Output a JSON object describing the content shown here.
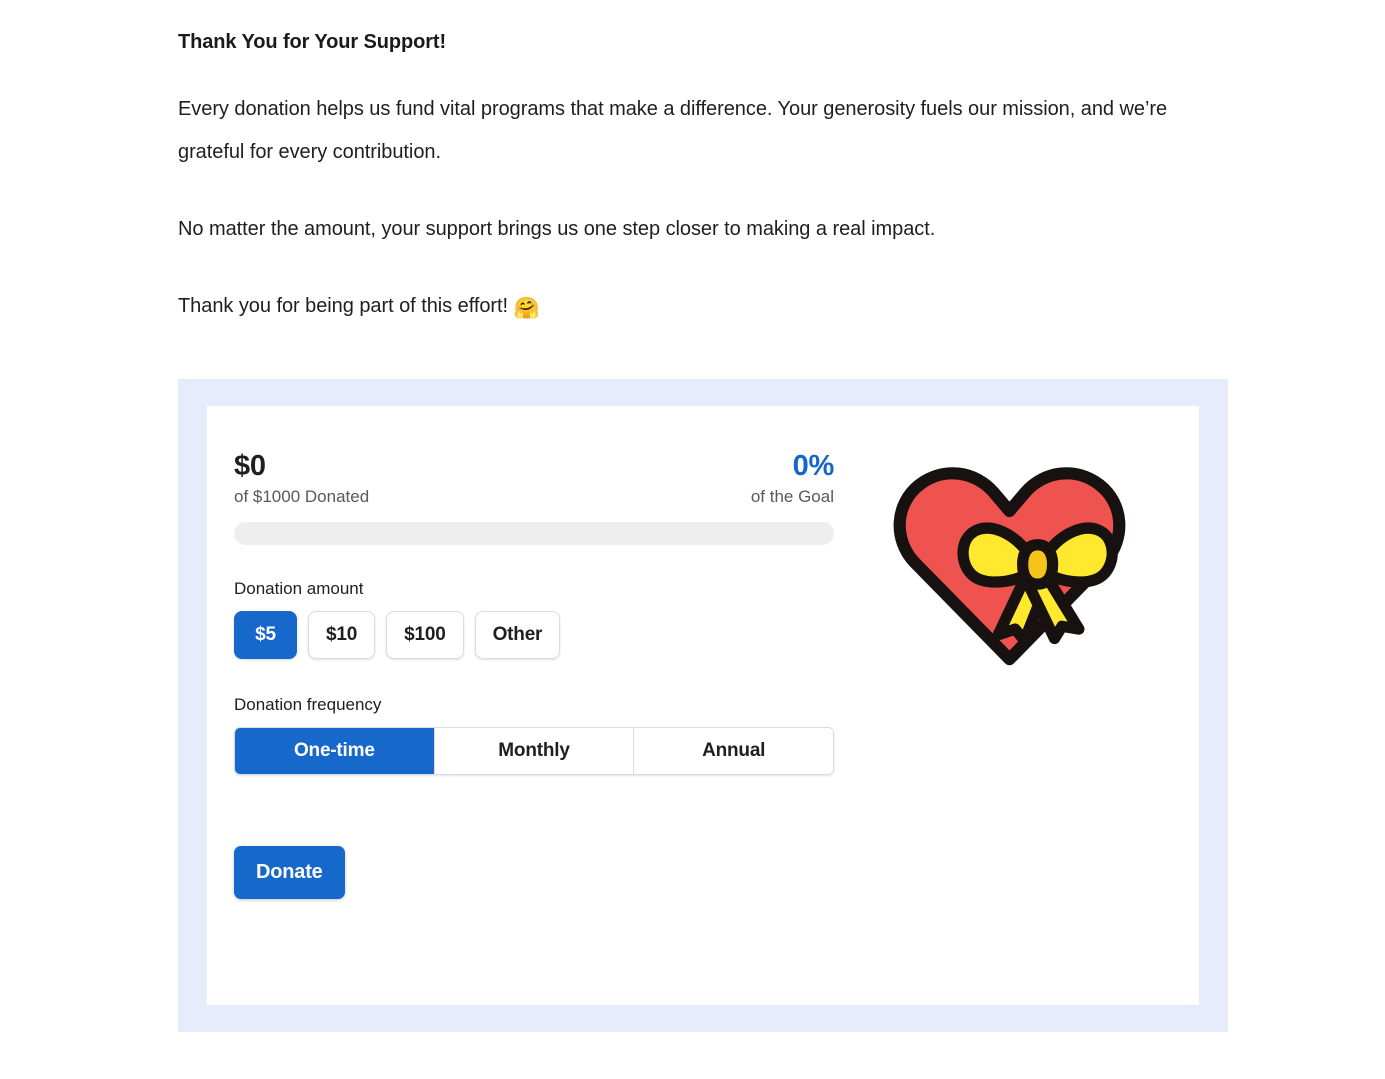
{
  "article": {
    "heading": "Thank You for Your Support!",
    "paragraphs": [
      "Every donation helps us fund vital programs that make a difference. Your generosity fuels our mission, and we’re grateful for every contribution.",
      "No matter the amount, your support brings us one step closer to making a real impact."
    ],
    "closing_text": "Thank you for being part of this effort! ",
    "closing_emoji": "🤗"
  },
  "widget": {
    "goal": {
      "raised_amount": "$0",
      "raised_caption": "of $1000 Donated",
      "percent": "0%",
      "percent_caption": "of the Goal",
      "progress_value": 0
    },
    "amount": {
      "label": "Donation amount",
      "options": [
        {
          "label": "$5",
          "selected": true
        },
        {
          "label": "$10",
          "selected": false
        },
        {
          "label": "$100",
          "selected": false
        },
        {
          "label": "Other",
          "selected": false
        }
      ]
    },
    "frequency": {
      "label": "Donation frequency",
      "options": [
        {
          "label": "One-time",
          "selected": true
        },
        {
          "label": "Monthly",
          "selected": false
        },
        {
          "label": "Annual",
          "selected": false
        }
      ]
    },
    "submit_label": "Donate",
    "illustration": "heart-with-ribbon-icon"
  },
  "colors": {
    "accent_blue": "#1668cb",
    "frame_blue": "#e6ecfb",
    "track_gray": "#eeeeee",
    "heart_red": "#ef5350",
    "bow_yellow": "#ffe92e",
    "bow_yellow_dark": "#f5c31a",
    "outline_black": "#17120f"
  }
}
